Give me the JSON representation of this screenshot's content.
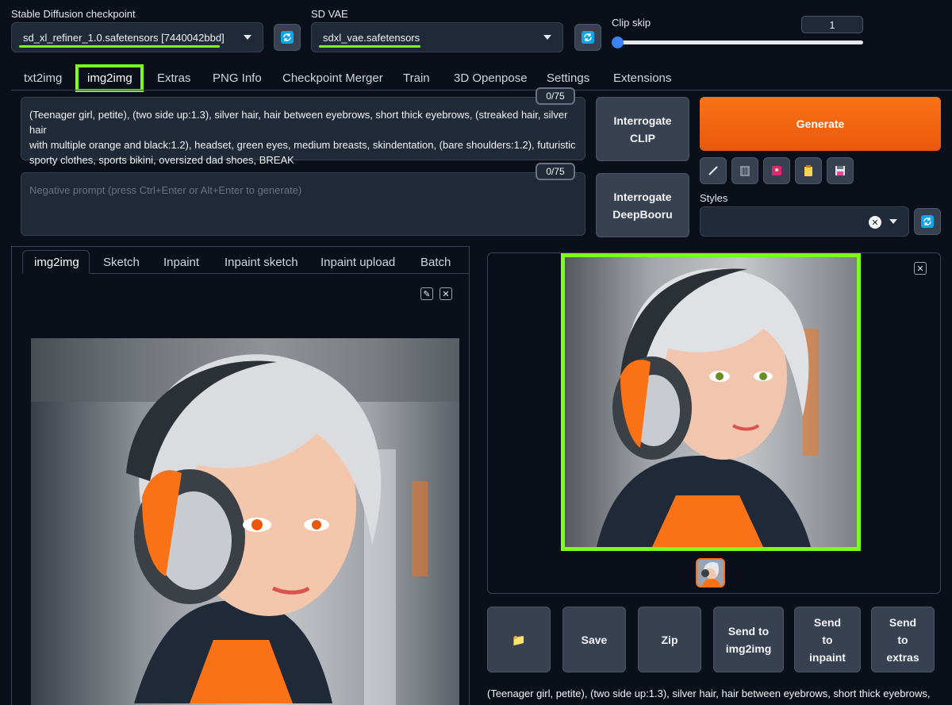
{
  "checkpoint": {
    "label": "Stable Diffusion checkpoint",
    "value": "sd_xl_refiner_1.0.safetensors [7440042bbd]"
  },
  "vae": {
    "label": "SD VAE",
    "value": "sdxl_vae.safetensors"
  },
  "clip_skip": {
    "label": "Clip skip",
    "value": "1",
    "level": 0.0
  },
  "tabs": [
    "txt2img",
    "img2img",
    "Extras",
    "PNG Info",
    "Checkpoint Merger",
    "Train",
    "3D Openpose",
    "Settings",
    "Extensions"
  ],
  "active_tab": "img2img",
  "prompt": {
    "counter": "0/75",
    "line1": "(Teenager girl, petite), (two side up:1.3), silver hair, hair between eyebrows, short thick eyebrows, (streaked hair, silver hair",
    "line2": "with multiple orange and black:1.2), headset, green eyes, medium breasts, skindentation, (bare shoulders:1.2), futuristic",
    "line3": "sporty clothes, sports bikini, oversized dad shoes, BREAK"
  },
  "negative_prompt": {
    "counter": "0/75",
    "placeholder": "Negative prompt (press Ctrl+Enter or Alt+Enter to generate)"
  },
  "interrogate_clip": {
    "line1": "Interrogate",
    "line2": "CLIP"
  },
  "interrogate_deepbooru": {
    "line1": "Interrogate",
    "line2": "DeepBooru"
  },
  "generate_label": "Generate",
  "styles_label": "Styles",
  "img_tabs": [
    "img2img",
    "Sketch",
    "Inpaint",
    "Inpaint sketch",
    "Inpaint upload",
    "Batch"
  ],
  "actions": {
    "folder": "📁",
    "save": "Save",
    "zip": "Zip",
    "send_img2img": {
      "line1": "Send to",
      "line2": "img2img"
    },
    "send_inpaint": {
      "line1": "Send",
      "line2": "to",
      "line3": "inpaint"
    },
    "send_extras": {
      "line1": "Send",
      "line2": "to",
      "line3": "extras"
    }
  },
  "output_caption": "(Teenager girl, petite), (two side up:1.3), silver hair, hair between eyebrows, short thick eyebrows,",
  "colors": {
    "accent": "#f97316",
    "highlight": "#7cff1a",
    "refresh": "#0ea5e9",
    "bg": "#0b0f19"
  }
}
